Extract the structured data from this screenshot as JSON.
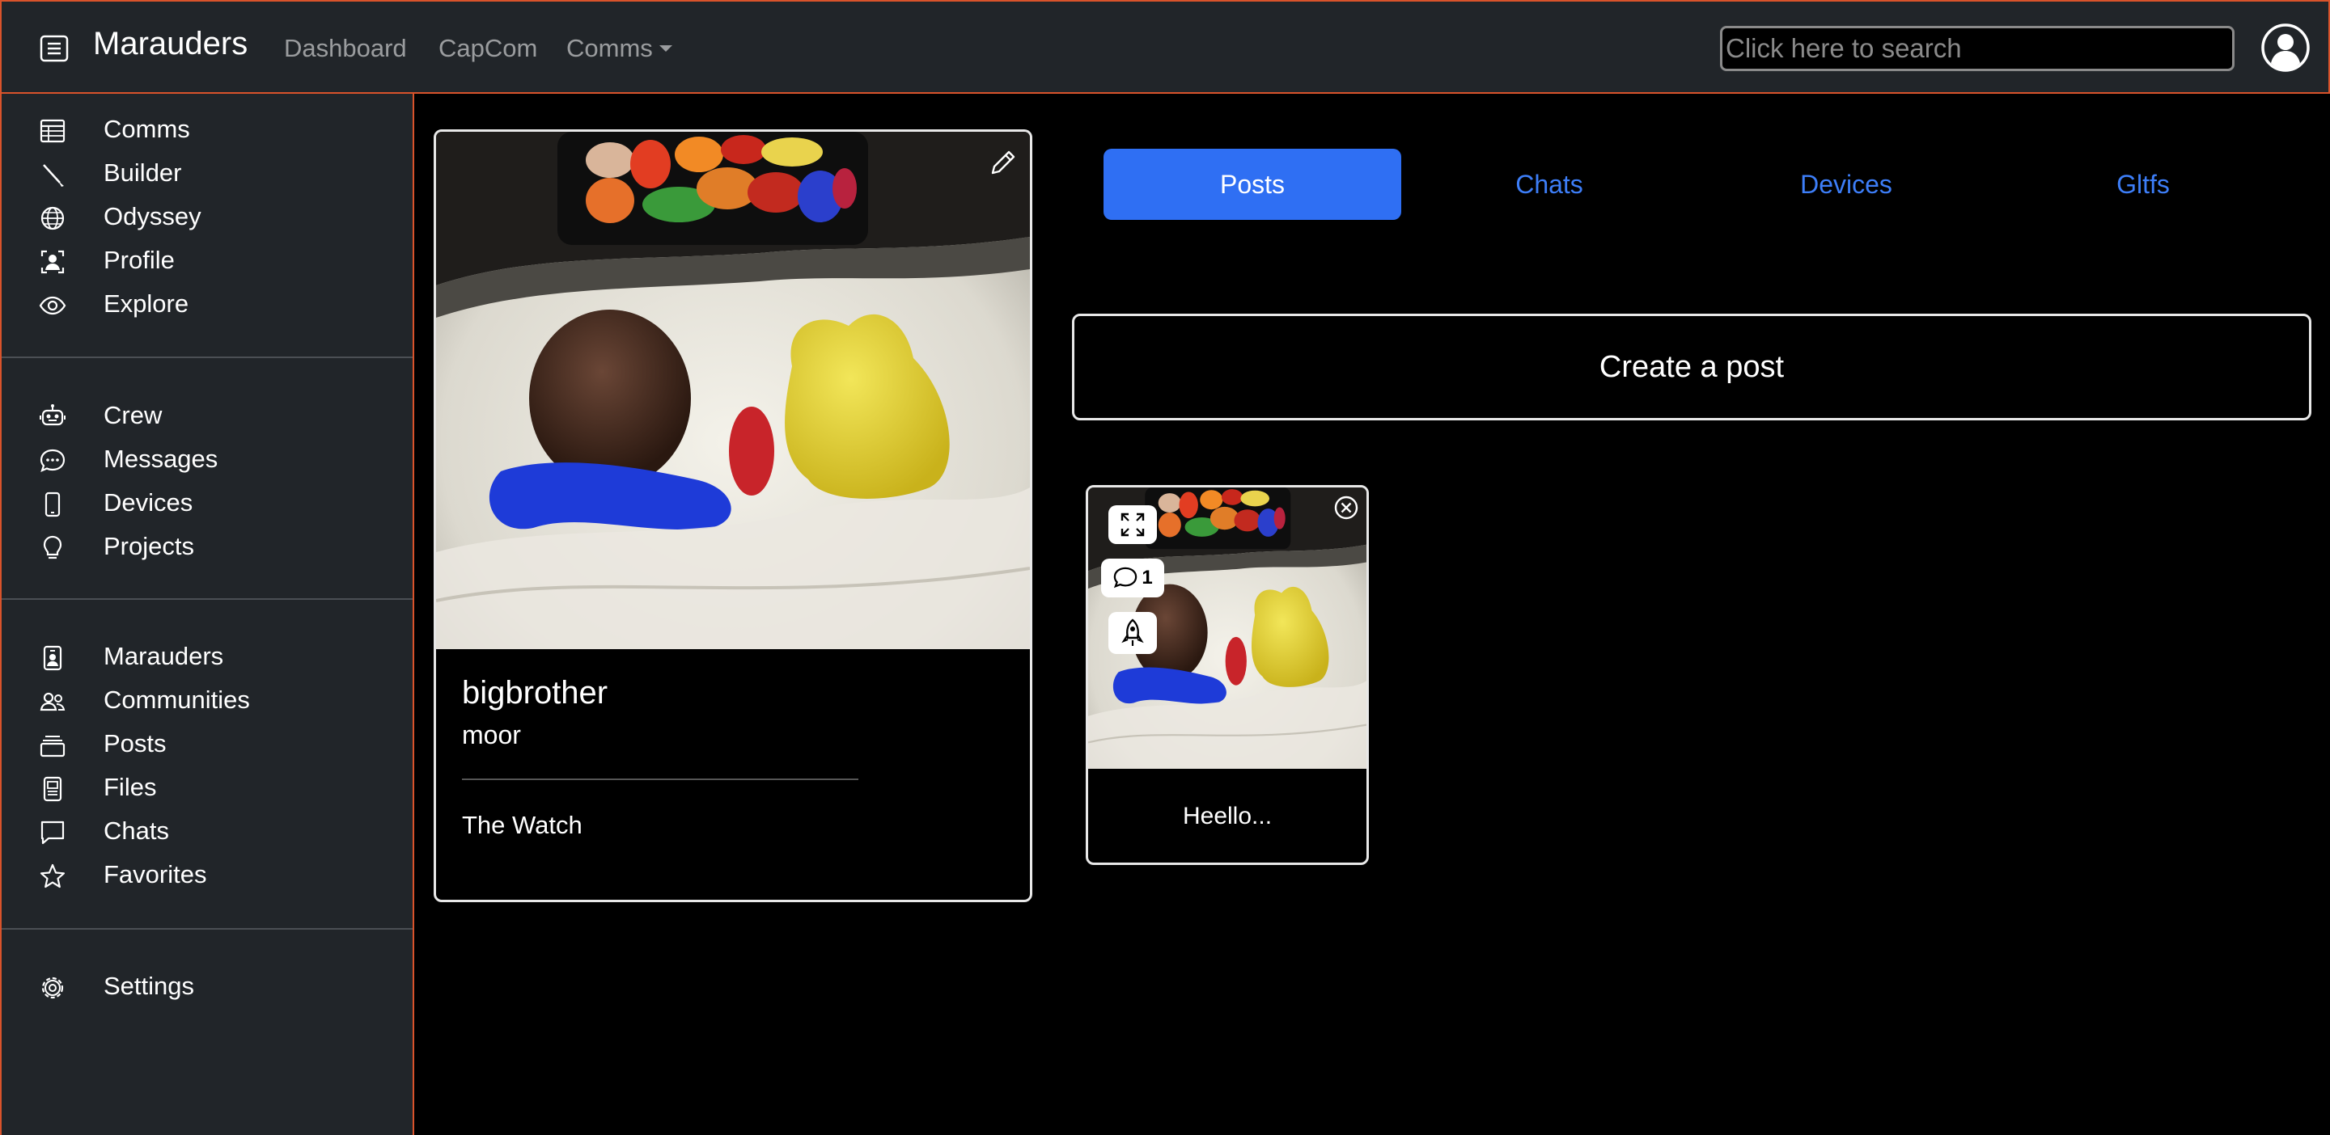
{
  "navbar": {
    "brand": "Marauders",
    "links": [
      {
        "label": "Dashboard"
      },
      {
        "label": "CapCom"
      },
      {
        "label": "Comms",
        "has_dropdown": true
      }
    ],
    "search_placeholder": "Click here to search"
  },
  "sidebar": {
    "groups": [
      [
        {
          "label": "Comms",
          "icon": "table-icon"
        },
        {
          "label": "Builder",
          "icon": "brush-icon"
        },
        {
          "label": "Odyssey",
          "icon": "globe-icon"
        },
        {
          "label": "Profile",
          "icon": "person-bounding-box-icon"
        },
        {
          "label": "Explore",
          "icon": "eye-icon"
        }
      ],
      [
        {
          "label": "Crew",
          "icon": "robot-icon"
        },
        {
          "label": "Messages",
          "icon": "chat-dots-icon"
        },
        {
          "label": "Devices",
          "icon": "phone-icon"
        },
        {
          "label": "Projects",
          "icon": "lightbulb-icon"
        }
      ],
      [
        {
          "label": "Marauders",
          "icon": "person-badge-icon"
        },
        {
          "label": "Communities",
          "icon": "people-icon"
        },
        {
          "label": "Posts",
          "icon": "collection-icon"
        },
        {
          "label": "Files",
          "icon": "file-icon"
        },
        {
          "label": "Chats",
          "icon": "chat-square-icon"
        },
        {
          "label": "Favorites",
          "icon": "star-icon"
        }
      ],
      [
        {
          "label": "Settings",
          "icon": "gear-icon"
        }
      ]
    ]
  },
  "profile": {
    "name": "bigbrother",
    "handle": "moor",
    "community": "The Watch"
  },
  "tabs": [
    {
      "label": "Posts",
      "active": true
    },
    {
      "label": "Chats",
      "active": false
    },
    {
      "label": "Devices",
      "active": false
    },
    {
      "label": "Gltfs",
      "active": false
    }
  ],
  "create_post_label": "Create a post",
  "posts": [
    {
      "caption": "Heello...",
      "comment_count": "1"
    }
  ],
  "colors": {
    "navbar_bg": "#212529",
    "accent_border": "#d9532b",
    "primary_blue": "#2f6ff3",
    "link_blue": "#3d7ef8"
  }
}
